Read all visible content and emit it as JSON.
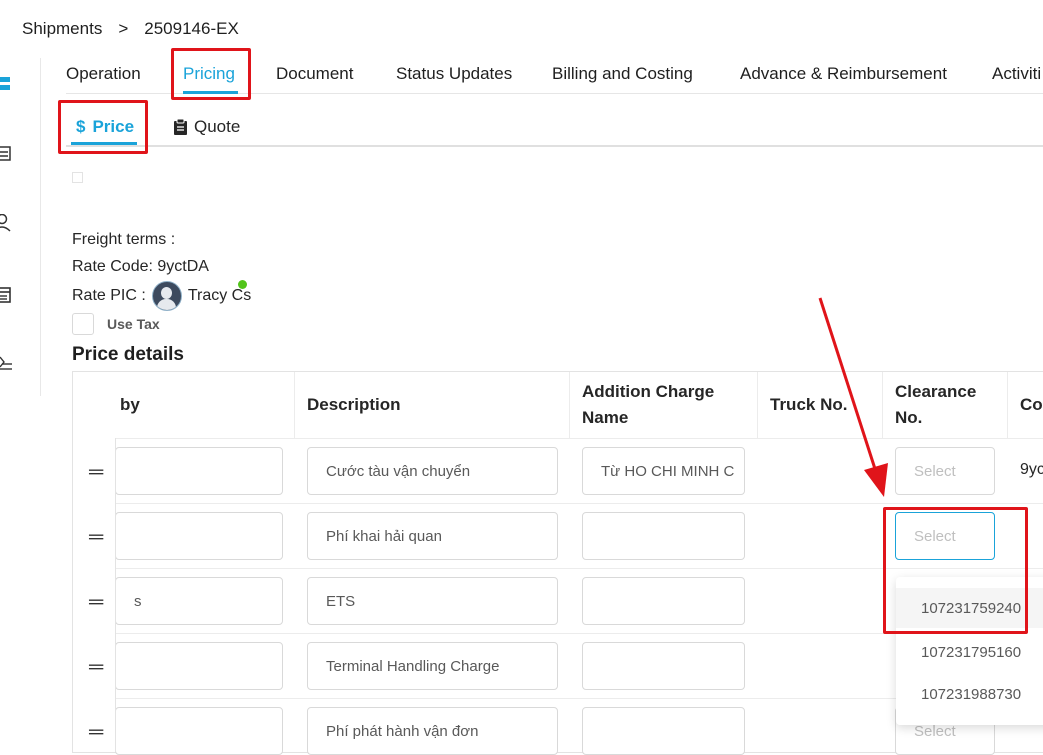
{
  "breadcrumb": {
    "root": "Shipments",
    "separator": ">",
    "current": "2509146-EX"
  },
  "tabs": [
    "Operation",
    "Pricing",
    "Document",
    "Status Updates",
    "Billing and Costing",
    "Advance & Reimbursement",
    "Activiti"
  ],
  "subtabs": {
    "price": "Price",
    "price_icon": "$",
    "quote": "Quote"
  },
  "info": {
    "freight_terms": "Freight terms :",
    "rate_code": "Rate Code: 9yctDA",
    "rate_pic_label": "Rate PIC :",
    "rate_pic_name": "Tracy Cs",
    "use_tax": "Use Tax"
  },
  "section_title": "Price details",
  "table": {
    "headers": {
      "by": "by",
      "description": "Description",
      "addition_charge_name": "Addition Charge Name",
      "truck_no": "Truck No.",
      "clearance_no": "Clearance No.",
      "next": "Col"
    },
    "rows": [
      {
        "by": "",
        "description": "Cước tàu vận chuyển",
        "addition": "Từ HO CHI MINH C",
        "clearance": "Select",
        "next": "9yc"
      },
      {
        "by": "",
        "description": "Phí khai hải quan",
        "addition": "",
        "clearance": "Select",
        "next": ""
      },
      {
        "by": "s",
        "description": "ETS",
        "addition": "",
        "clearance": "",
        "next": ""
      },
      {
        "by": "",
        "description": "Terminal Handling Charge",
        "addition": "",
        "clearance": "",
        "next": ""
      },
      {
        "by": "",
        "description": "Phí phát hành vận đơn",
        "addition": "",
        "clearance": "Select",
        "next": ""
      }
    ]
  },
  "dropdown_options": [
    "107231759240",
    "107231795160",
    "107231988730"
  ],
  "colors": {
    "accent": "#1aa3d9",
    "highlight": "#e0141a",
    "online": "#52c41a"
  }
}
